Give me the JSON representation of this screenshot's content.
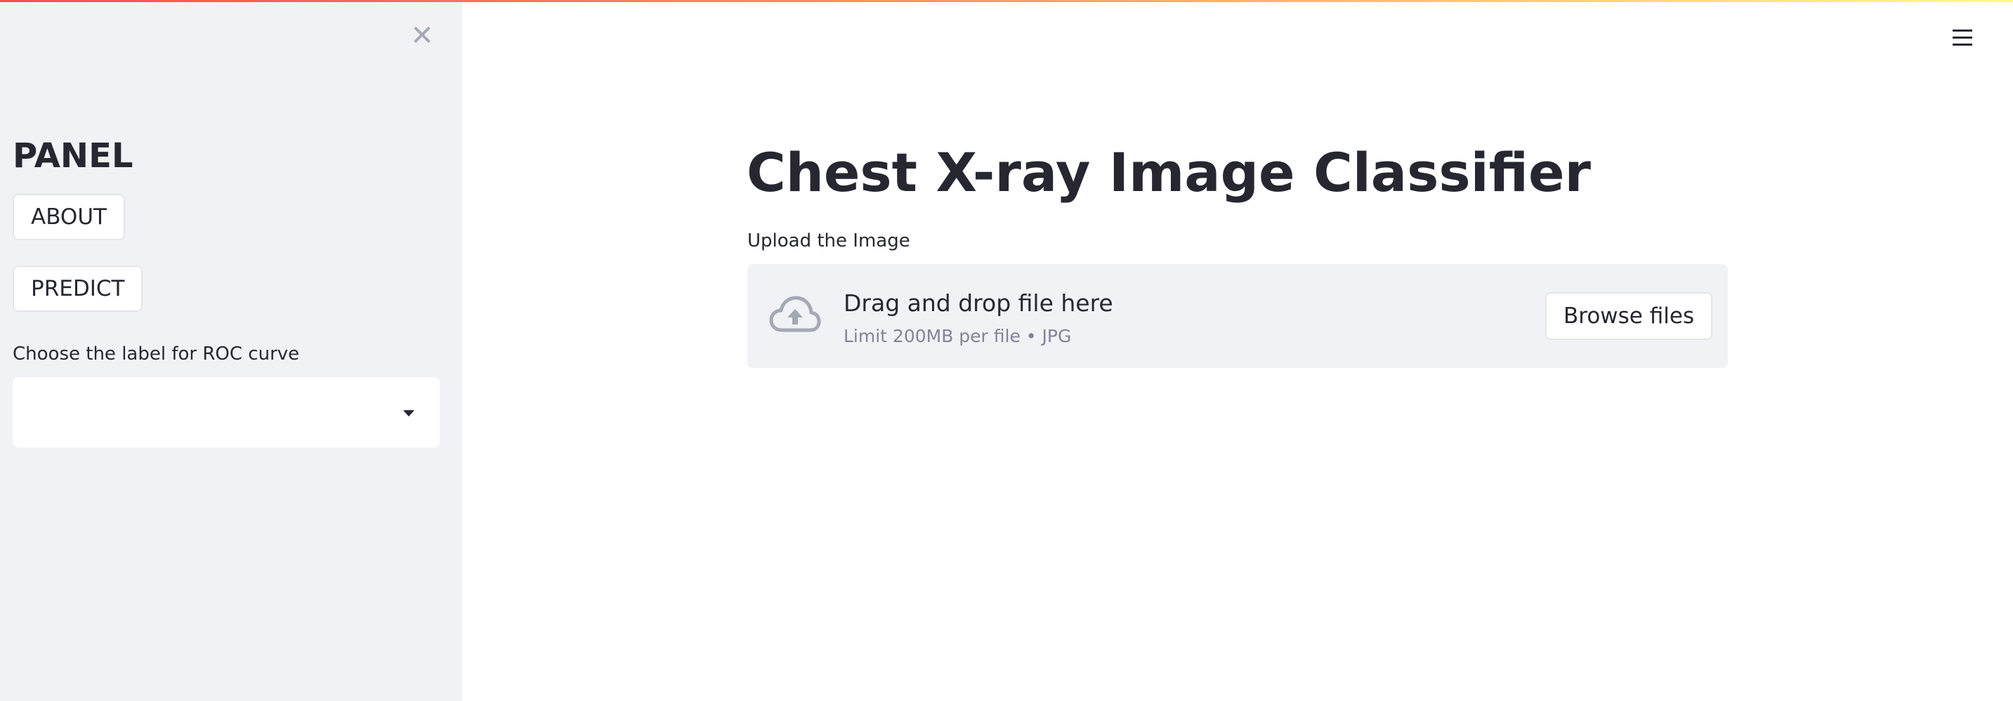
{
  "colors": {
    "sidebar_bg": "#f0f2f6",
    "text": "#262730",
    "muted_text": "#808495",
    "icon_gray": "#a3a8b4",
    "decoration_gradient": [
      "#ff4b4b",
      "#fffd80"
    ]
  },
  "sidebar": {
    "close_icon": "close-icon",
    "heading": "PANEL",
    "buttons": {
      "about": "ABOUT",
      "predict": "PREDICT"
    },
    "roc_select": {
      "label": "Choose the label for ROC curve",
      "value": "",
      "icon": "chevron-down-icon"
    }
  },
  "header": {
    "menu_icon": "hamburger-menu-icon"
  },
  "main": {
    "title": "Chest X-ray Image Classifier",
    "uploader": {
      "label": "Upload the Image",
      "icon": "cloud-upload-icon",
      "drop_title": "Drag and drop file here",
      "drop_subtitle": "Limit 200MB per file • JPG",
      "browse_label": "Browse files"
    }
  }
}
